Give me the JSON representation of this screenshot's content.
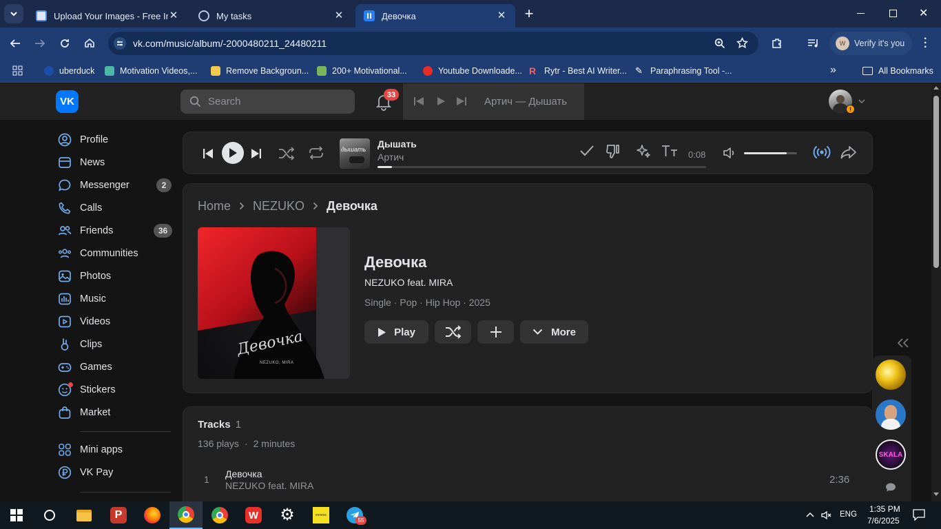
{
  "browser": {
    "tabs": [
      {
        "title": "Upload Your Images - Free Imag",
        "active": false
      },
      {
        "title": "My tasks",
        "active": false
      },
      {
        "title": "Девочка",
        "active": true
      }
    ],
    "url": "vk.com/music/album/-2000480211_24480211",
    "profile_label": "Verify it's you",
    "bookmarks": [
      "uberduck",
      "Motivation Videos,...",
      "Remove Backgroun...",
      "200+ Motivational...",
      "Youtube Downloade...",
      "Rytr - Best AI Writer...",
      "Paraphrasing Tool -..."
    ],
    "all_bookmarks": "All Bookmarks"
  },
  "header": {
    "logo": "VK",
    "search_placeholder": "Search",
    "notifications_count": "33",
    "mini_player_text": "Артич — Дышать",
    "avatar_badge": "!"
  },
  "sidebar": {
    "items": [
      {
        "label": "Profile",
        "icon": "profile-icon"
      },
      {
        "label": "News",
        "icon": "news-icon"
      },
      {
        "label": "Messenger",
        "icon": "messenger-icon",
        "count": "2"
      },
      {
        "label": "Calls",
        "icon": "calls-icon"
      },
      {
        "label": "Friends",
        "icon": "friends-icon",
        "count": "36"
      },
      {
        "label": "Communities",
        "icon": "communities-icon"
      },
      {
        "label": "Photos",
        "icon": "photos-icon"
      },
      {
        "label": "Music",
        "icon": "music-icon"
      },
      {
        "label": "Videos",
        "icon": "videos-icon"
      },
      {
        "label": "Clips",
        "icon": "clips-icon"
      },
      {
        "label": "Games",
        "icon": "games-icon"
      },
      {
        "label": "Stickers",
        "icon": "stickers-icon"
      },
      {
        "label": "Market",
        "icon": "market-icon"
      }
    ],
    "extra": [
      {
        "label": "Mini apps",
        "icon": "mini-apps-icon"
      },
      {
        "label": "VK Pay",
        "icon": "vk-pay-icon"
      }
    ]
  },
  "player": {
    "track_title": "Дышать",
    "track_artist": "Артич",
    "cover_text": "дышать",
    "time": "0:08",
    "progress": 0.045,
    "volume": 0.81
  },
  "album": {
    "breadcrumb": [
      "Home",
      "NEZUKO",
      "Девочка"
    ],
    "title": "Девочка",
    "artist": "NEZUKO feat. MIRA",
    "meta": "Single · Pop · Hip Hop · 2025",
    "cover_script": "Девочка",
    "cover_caption": "NEZUKO, MIRA",
    "buttons": {
      "play": "Play",
      "more": "More"
    }
  },
  "tracks": {
    "heading": "Tracks",
    "count": "1",
    "plays": "136 plays",
    "duration_total": "2 minutes",
    "list": [
      {
        "number": "1",
        "title": "Девочка",
        "artist": "NEZUKO feat. MIRA",
        "duration": "2:36"
      }
    ]
  },
  "right_rail": {
    "skala_label": "SKALA"
  },
  "taskbar": {
    "language": "ENG",
    "time": "1:35 PM",
    "date": "7/6/2025",
    "telegram_badge": "55"
  },
  "colors": {
    "accent": "#71aaeb",
    "vk_blue": "#0077ff",
    "chrome_tab": "#1b2a4a",
    "chrome_toolbar": "#1f3d72",
    "badge_red": "#e64646",
    "panel": "#222222",
    "page_bg": "#141414"
  }
}
